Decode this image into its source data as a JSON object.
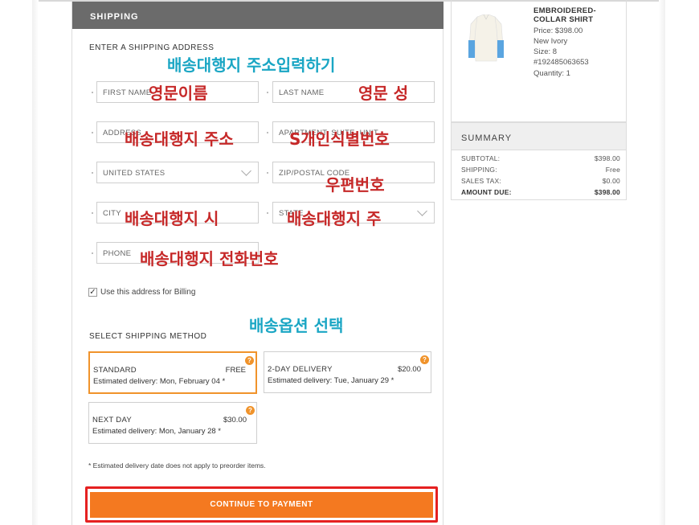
{
  "shipping_header": "SHIPPING",
  "address_section_label": "ENTER A SHIPPING ADDRESS",
  "fields": {
    "first_name": "FIRST NAME",
    "last_name": "LAST NAME",
    "address": "ADDRESS",
    "apartment": "APARTMENT, SUITE, UNIT",
    "country": "UNITED STATES",
    "zip": "ZIP/POSTAL CODE",
    "city": "CITY",
    "state": "STATE",
    "phone": "PHONE"
  },
  "annotations": {
    "address_input": "배송대행지 주소입력하기",
    "first_name": "영문이름",
    "last_name": "영문 성",
    "address": "배송대행지 주소",
    "apartment": "S개인식별번호",
    "zip": "우편번호",
    "city": "배송대행지 시",
    "state": "배송대행지 주",
    "phone": "배송대행지 전화번호",
    "shipping_option": "배송옵션 선택"
  },
  "billing_checkbox": {
    "checked": true,
    "mark": "✓",
    "label": "Use this address for Billing"
  },
  "shipping_method_label": "SELECT SHIPPING METHOD",
  "methods": [
    {
      "name": "STANDARD",
      "price": "FREE",
      "eta": "Estimated delivery: Mon, February 04 *",
      "selected": true
    },
    {
      "name": "2-DAY DELIVERY",
      "price": "$20.00",
      "eta": "Estimated delivery: Tue, January 29 *",
      "selected": false
    },
    {
      "name": "NEXT DAY",
      "price": "$30.00",
      "eta": "Estimated delivery: Mon, January 28 *",
      "selected": false
    }
  ],
  "help_icon_glyph": "?",
  "footnote": "* Estimated delivery date does not apply to preorder items.",
  "continue_button": "CONTINUE TO PAYMENT",
  "product": {
    "name_line1": "EMBROIDERED-",
    "name_line2": "COLLAR SHIRT",
    "price": "Price:  $398.00",
    "color": "New Ivory",
    "size": "Size:  8",
    "sku": "#192485063653",
    "quantity": "Quantity: 1"
  },
  "summary": {
    "title": "SUMMARY",
    "rows": [
      {
        "label": "SUBTOTAL:",
        "value": "$398.00"
      },
      {
        "label": "SHIPPING:",
        "value": "Free"
      },
      {
        "label": "SALES TAX:",
        "value": "$0.00"
      },
      {
        "label": "AMOUNT DUE:",
        "value": "$398.00"
      }
    ]
  },
  "colors": {
    "header_bg": "#6b6b6b",
    "accent_orange": "#f47920",
    "annotation_red": "#c62828",
    "annotation_teal": "#1aa6c4",
    "highlight_border": "#e52020"
  }
}
